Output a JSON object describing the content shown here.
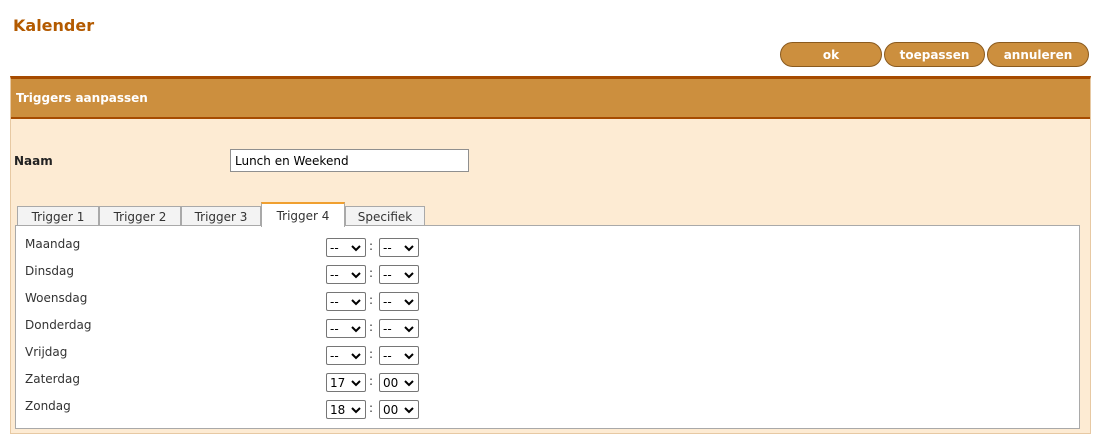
{
  "page": {
    "title": "Kalender"
  },
  "toolbar": {
    "ok_label": "ok",
    "apply_label": "toepassen",
    "cancel_label": "annuleren"
  },
  "panel": {
    "title": "Triggers aanpassen"
  },
  "form": {
    "name_label": "Naam",
    "name_value": "Lunch en Weekend"
  },
  "tabs": [
    {
      "label": "Trigger 1",
      "active": false
    },
    {
      "label": "Trigger 2",
      "active": false
    },
    {
      "label": "Trigger 3",
      "active": false
    },
    {
      "label": "Trigger 4",
      "active": true
    },
    {
      "label": "Specifiek",
      "active": false
    }
  ],
  "separator": ":",
  "icons": {
    "dropdown": "chevron-down-icon"
  },
  "colors": {
    "title": "#b35a00",
    "accent": "#cc8f3e",
    "border_dark": "#a64b00",
    "panel_bg": "#fdebd3",
    "active_tab": "#f0a030"
  },
  "days": [
    {
      "label": "Maandag",
      "hour": "--",
      "minute": "--"
    },
    {
      "label": "Dinsdag",
      "hour": "--",
      "minute": "--"
    },
    {
      "label": "Woensdag",
      "hour": "--",
      "minute": "--"
    },
    {
      "label": "Donderdag",
      "hour": "--",
      "minute": "--"
    },
    {
      "label": "Vrijdag",
      "hour": "--",
      "minute": "--"
    },
    {
      "label": "Zaterdag",
      "hour": "17",
      "minute": "00"
    },
    {
      "label": "Zondag",
      "hour": "18",
      "minute": "00"
    }
  ]
}
